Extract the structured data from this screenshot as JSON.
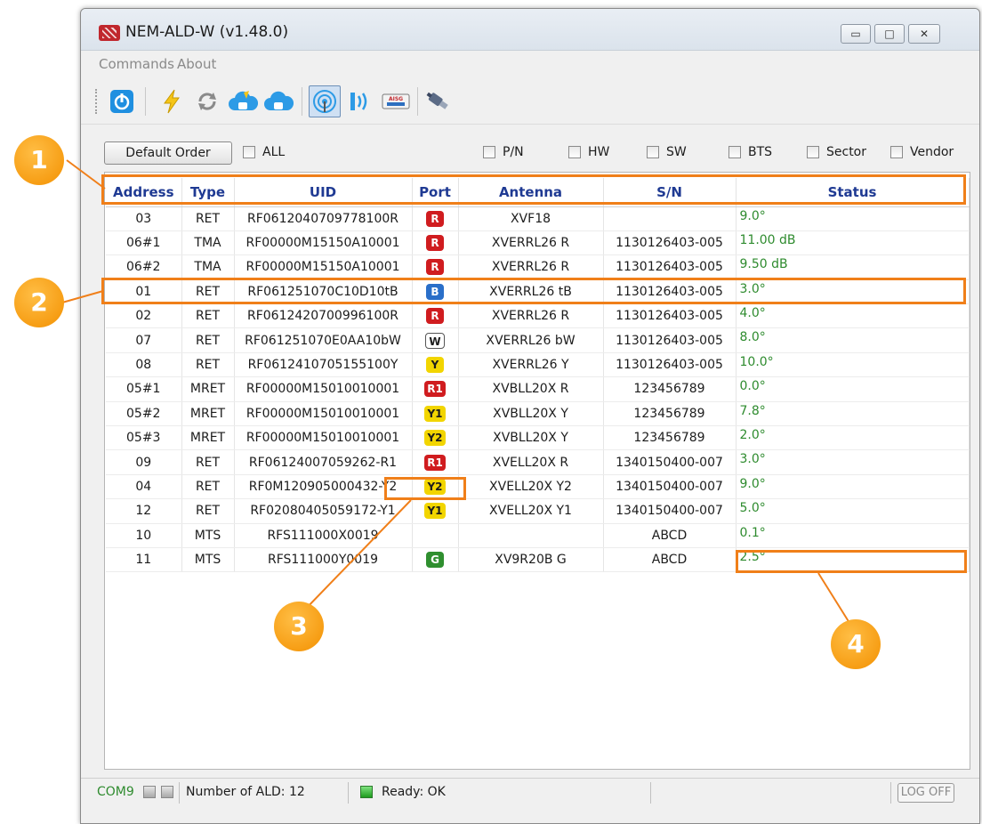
{
  "window": {
    "title": "NEM-ALD-W (v1.48.0)",
    "controls": {
      "minimize": "▭",
      "maximize": "□",
      "close": "✕"
    }
  },
  "menu": {
    "items": [
      "Commands",
      "About"
    ]
  },
  "toolbar": {
    "buttons": [
      {
        "icon": "power-icon"
      },
      {
        "icon": "lightning-icon"
      },
      {
        "icon": "refresh-icon"
      },
      {
        "icon": "cloud-download-icon"
      },
      {
        "icon": "cloud-upload-icon"
      },
      {
        "icon": "antenna-scan-icon",
        "active": true
      },
      {
        "icon": "signal-wave-icon"
      },
      {
        "icon": "aisg-icon",
        "label": "AISG"
      },
      {
        "icon": "connector-icon"
      }
    ]
  },
  "filters": {
    "default_order_label": "Default Order",
    "all_label": "ALL",
    "columns": [
      "P/N",
      "HW",
      "SW",
      "BTS",
      "Sector",
      "Vendor"
    ]
  },
  "table": {
    "headers": [
      "Address",
      "Type",
      "UID",
      "Port",
      "Antenna",
      "S/N",
      "Status"
    ],
    "rows": [
      {
        "address": "03",
        "type": "RET",
        "uid": "RF0612040709778100R",
        "port": "R",
        "port_color": "R",
        "antenna": "XVF18",
        "sn": "",
        "status": "9.0°"
      },
      {
        "address": "06#1",
        "type": "TMA",
        "uid": "RF00000M15150A10001",
        "port": "R",
        "port_color": "R",
        "antenna": "XVERRL26 R",
        "sn": "1130126403-005",
        "status": "11.00 dB"
      },
      {
        "address": "06#2",
        "type": "TMA",
        "uid": "RF00000M15150A10001",
        "port": "R",
        "port_color": "R",
        "antenna": "XVERRL26 R",
        "sn": "1130126403-005",
        "status": "9.50 dB"
      },
      {
        "address": "01",
        "type": "RET",
        "uid": "RF061251070C10D10tB",
        "port": "B",
        "port_color": "B",
        "antenna": "XVERRL26 tB",
        "sn": "1130126403-005",
        "status": "3.0°"
      },
      {
        "address": "02",
        "type": "RET",
        "uid": "RF0612420700996100R",
        "port": "R",
        "port_color": "R",
        "antenna": "XVERRL26 R",
        "sn": "1130126403-005",
        "status": "4.0°"
      },
      {
        "address": "07",
        "type": "RET",
        "uid": "RF061251070E0AA10bW",
        "port": "W",
        "port_color": "W",
        "antenna": "XVERRL26 bW",
        "sn": "1130126403-005",
        "status": "8.0°"
      },
      {
        "address": "08",
        "type": "RET",
        "uid": "RF0612410705155100Y",
        "port": "Y",
        "port_color": "Y",
        "antenna": "XVERRL26 Y",
        "sn": "1130126403-005",
        "status": "10.0°"
      },
      {
        "address": "05#1",
        "type": "MRET",
        "uid": "RF00000M15010010001",
        "port": "R1",
        "port_color": "R",
        "antenna": "XVBLL20X R",
        "sn": "123456789",
        "status": "0.0°"
      },
      {
        "address": "05#2",
        "type": "MRET",
        "uid": "RF00000M15010010001",
        "port": "Y1",
        "port_color": "Y",
        "antenna": "XVBLL20X Y",
        "sn": "123456789",
        "status": "7.8°"
      },
      {
        "address": "05#3",
        "type": "MRET",
        "uid": "RF00000M15010010001",
        "port": "Y2",
        "port_color": "Y",
        "antenna": "XVBLL20X Y",
        "sn": "123456789",
        "status": "2.0°"
      },
      {
        "address": "09",
        "type": "RET",
        "uid": "RF06124007059262-R1",
        "port": "R1",
        "port_color": "R",
        "antenna": "XVELL20X R",
        "sn": "1340150400-007",
        "status": "3.0°"
      },
      {
        "address": "04",
        "type": "RET",
        "uid": "RF0M120905000432-Y2",
        "port": "Y2",
        "port_color": "Y",
        "antenna": "XVELL20X Y2",
        "sn": "1340150400-007",
        "status": "9.0°"
      },
      {
        "address": "12",
        "type": "RET",
        "uid": "RF02080405059172-Y1",
        "port": "Y1",
        "port_color": "Y",
        "antenna": "XVELL20X Y1",
        "sn": "1340150400-007",
        "status": "5.0°"
      },
      {
        "address": "10",
        "type": "MTS",
        "uid": "RFS111000X0019",
        "port": "",
        "port_color": "",
        "antenna": "",
        "sn": "ABCD",
        "status": "0.1°"
      },
      {
        "address": "11",
        "type": "MTS",
        "uid": "RFS111000Y0019",
        "port": "G",
        "port_color": "G",
        "antenna": "XV9R20B G",
        "sn": "ABCD",
        "status": "2.5°"
      }
    ]
  },
  "statusbar": {
    "com_port": "COM9",
    "ald_count": "Number of ALD: 12",
    "ready": "Ready: OK",
    "logoff": "LOG OFF"
  },
  "callouts": [
    "1",
    "2",
    "3",
    "4"
  ],
  "colors": {
    "accent": "#f07f19",
    "header_text": "#1f3a93",
    "status_text": "#2e8b2e"
  }
}
